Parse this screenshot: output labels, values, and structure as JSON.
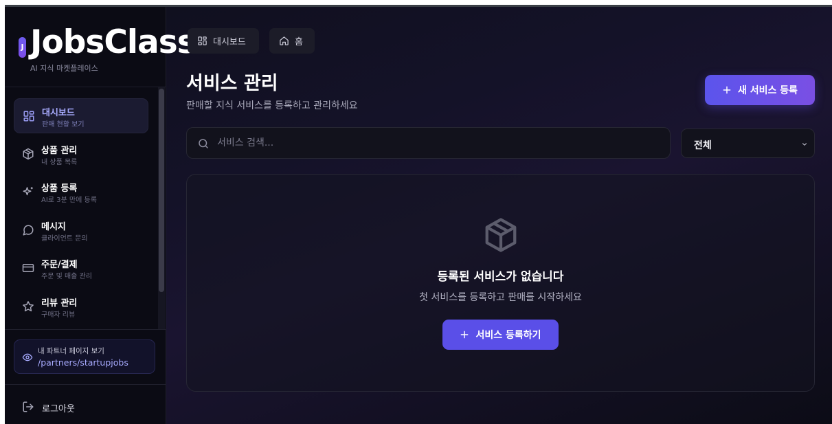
{
  "brand": {
    "badge": "J",
    "name": "JobsClass",
    "subtitle": "AI 지식 마켓플레이스"
  },
  "sidebar": {
    "items": [
      {
        "label": "대시보드",
        "desc": "판매 현황 보기",
        "icon": "dashboard-grid-icon",
        "active": true
      },
      {
        "label": "상품 관리",
        "desc": "내 상품 목록",
        "icon": "package-icon",
        "active": false
      },
      {
        "label": "상품 등록",
        "desc": "AI로 3분 만에 등록",
        "icon": "sparkles-icon",
        "active": false
      },
      {
        "label": "메시지",
        "desc": "클라이언트 문의",
        "icon": "message-icon",
        "active": false
      },
      {
        "label": "주문/결제",
        "desc": "주문 및 매출 관리",
        "icon": "credit-card-icon",
        "active": false
      },
      {
        "label": "리뷰 관리",
        "desc": "구매자 리뷰",
        "icon": "star-icon",
        "active": false
      }
    ],
    "partner": {
      "label": "내 파트너 페이지 보기",
      "url": "/partners/startupjobs"
    },
    "logout": "로그아웃"
  },
  "topbar": {
    "dashboard": "대시보드",
    "home": "홈"
  },
  "header": {
    "title": "서비스 관리",
    "subtitle": "판매할 지식 서비스를 등록하고 관리하세요",
    "new_button": "새 서비스 등록"
  },
  "filters": {
    "search_placeholder": "서비스 검색...",
    "select_value": "전체"
  },
  "empty": {
    "title": "등록된 서비스가 없습니다",
    "subtitle": "첫 서비스를 등록하고 판매를 시작하세요",
    "button": "서비스 등록하기"
  },
  "colors": {
    "accent": "#5b54ec",
    "accent_text": "#a8abff",
    "background": "#0f0f1c"
  }
}
